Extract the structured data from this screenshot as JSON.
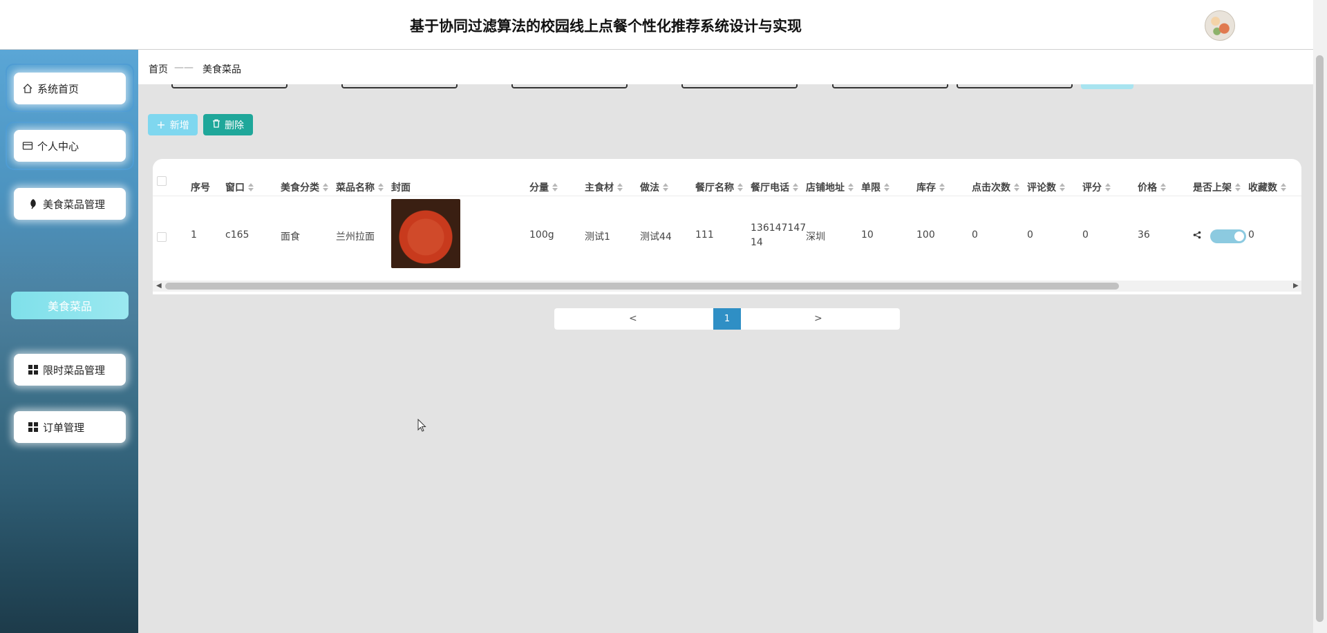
{
  "header": {
    "title": "基于协同过滤算法的校园线上点餐个性化推荐系统设计与实现"
  },
  "sidebar": {
    "items": [
      {
        "label": "系统首页",
        "icon": "home-icon"
      },
      {
        "label": "个人中心",
        "icon": "card-icon"
      },
      {
        "label": "美食菜品管理",
        "icon": "leaf-icon"
      },
      {
        "label": "美食菜品",
        "icon": ""
      },
      {
        "label": "限时菜品管理",
        "icon": "grid-icon"
      },
      {
        "label": "订单管理",
        "icon": "grid-icon"
      }
    ]
  },
  "breadcrumb": {
    "home": "首页",
    "separator": "——",
    "current": "美食菜品"
  },
  "toolbar": {
    "add_label": "新增",
    "delete_label": "删除"
  },
  "table": {
    "headers": [
      "序号",
      "窗口",
      "美食分类",
      "菜品名称",
      "封面",
      "分量",
      "主食材",
      "做法",
      "餐厅名称",
      "餐厅电话",
      "店铺地址",
      "单限",
      "库存",
      "点击次数",
      "评论数",
      "评分",
      "价格",
      "是否上架",
      "收藏数"
    ],
    "rows": [
      {
        "index": "1",
        "window": "c165",
        "category": "面食",
        "name": "兰州拉面",
        "portion": "100g",
        "ingredient": "测试1",
        "method": "测试44",
        "restaurant": "111",
        "phone_line1": "136147147",
        "phone_line2": "14",
        "address": "深圳",
        "limit": "10",
        "stock": "100",
        "clicks": "0",
        "comments": "0",
        "rating": "0",
        "price": "36",
        "favorites": "0"
      }
    ]
  },
  "pagination": {
    "prev": "<",
    "current": "1",
    "next": ">"
  },
  "colors": {
    "accent": "#7fd7ef",
    "delete": "#1fa79a",
    "page_active": "#2f8fc5"
  }
}
